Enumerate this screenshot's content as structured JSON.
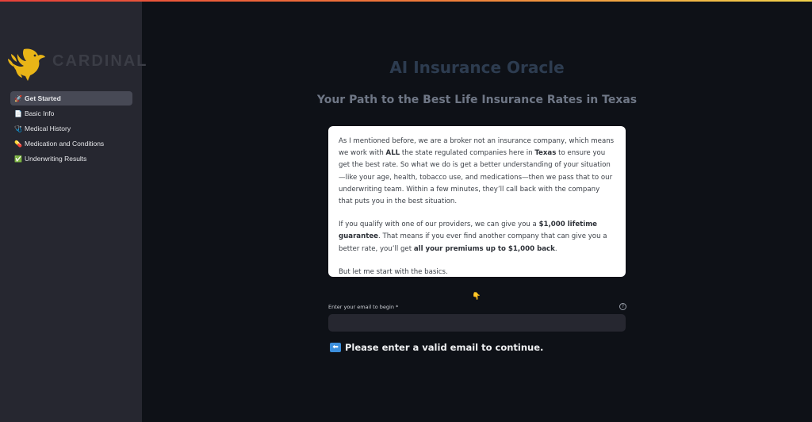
{
  "brand": {
    "name": "CARDINAL",
    "tagline": "",
    "gold": "#e9b517",
    "bar_gradient": [
      "#e8413a",
      "#ef7d3a",
      "#f1d34b"
    ]
  },
  "sidebar": {
    "items": [
      {
        "icon": "rocket-icon",
        "glyph": "🚀",
        "label": "Get Started",
        "active": true
      },
      {
        "icon": "document-icon",
        "glyph": "📄",
        "label": "Basic Info",
        "active": false
      },
      {
        "icon": "stethoscope-icon",
        "glyph": "🩺",
        "label": "Medical History",
        "active": false
      },
      {
        "icon": "pill-icon",
        "glyph": "💊",
        "label": "Medication and Conditions",
        "active": false
      },
      {
        "icon": "check-icon",
        "glyph": "✅",
        "label": "Underwriting Results",
        "active": false
      }
    ]
  },
  "main": {
    "title": "AI Insurance Oracle",
    "subtitle": "Your Path to the Best Life Insurance Rates in Texas",
    "card": {
      "p1_a": "As I mentioned before, we are a broker not an insurance company, which means we work with ",
      "p1_b": "ALL",
      "p1_c": " the state regulated companies here in ",
      "p1_d": "Texas",
      "p1_e": " to ensure you get the best rate. So what we do is get a better understanding of your situation—like your age, health, tobacco use, and medications—then we pass that to our underwriting team. Within a few minutes, they’ll call back with the company that puts you in the best situation.",
      "p2_a": "If you qualify with one of our providers, we can give you a ",
      "p2_b": "$1,000 lifetime guarantee",
      "p2_c": ". That means if you ever find another company that can give you a better rate, you’ll get ",
      "p2_d": "all your premiums up to $1,000 back",
      "p2_e": ".",
      "p3": "But let me start with the basics."
    },
    "pointer_glyph": "👇",
    "email": {
      "label": "Enter your email to begin *",
      "value": "",
      "placeholder": "",
      "help_glyph": "?"
    },
    "warning": {
      "icon": "left-arrow-icon",
      "glyph": "⬅",
      "text": "Please enter a valid email to continue."
    }
  }
}
